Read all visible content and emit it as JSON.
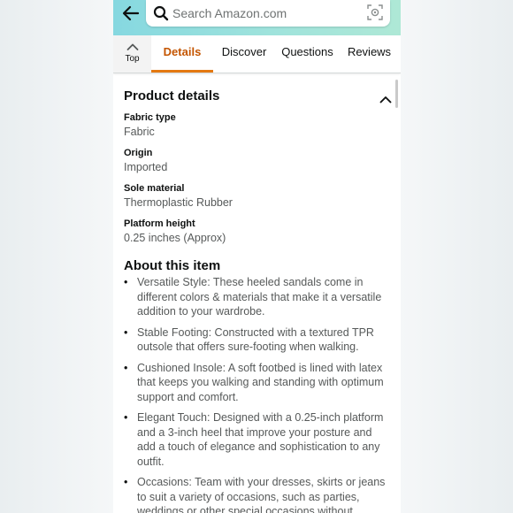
{
  "search": {
    "placeholder": "Search Amazon.com"
  },
  "tabs": {
    "top_label": "Top",
    "items": [
      {
        "label": "Details",
        "active": true
      },
      {
        "label": "Discover",
        "active": false
      },
      {
        "label": "Questions",
        "active": false
      },
      {
        "label": "Reviews",
        "active": false
      }
    ]
  },
  "product_details": {
    "title": "Product details",
    "rows": [
      {
        "label": "Fabric type",
        "value": "Fabric"
      },
      {
        "label": "Origin",
        "value": "Imported"
      },
      {
        "label": "Sole material",
        "value": "Thermoplastic Rubber"
      },
      {
        "label": "Platform height",
        "value": "0.25 inches (Approx)"
      }
    ]
  },
  "about": {
    "title": "About this item",
    "bullets": [
      "Versatile Style: These heeled sandals come in different colors & materials that make it a versatile addition to your wardrobe.",
      "Stable Footing: Constructed with a textured TPR outsole that offers sure-footing when walking.",
      "Cushioned Insole: A soft footbed is lined with latex that keeps you walking and standing with optimum support and comfort.",
      "Elegant Touch: Designed with a 0.25-inch platform and a 3-inch heel that improve your posture and add a touch of elegance and sophistication to any outfit.",
      "Occasions: Team with your dresses, skirts or jeans to suit a variety of occasions, such as parties, weddings or other special occasions without"
    ]
  },
  "colors": {
    "accent": "#e47911",
    "active_tab_text": "#c45500",
    "header_gradient": "#9fe3dc"
  },
  "icons": [
    "back-arrow-icon",
    "search-icon",
    "camera-icon",
    "chevron-up-icon"
  ]
}
